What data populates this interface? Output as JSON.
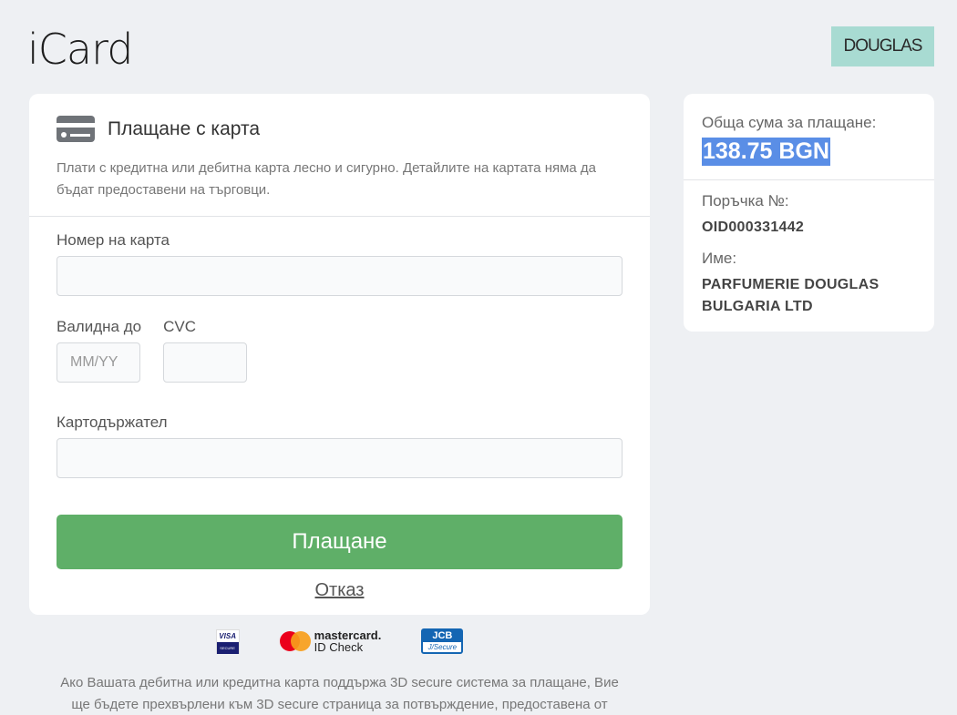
{
  "brand": {
    "name": "iCard"
  },
  "merchant": {
    "logo_text": "DOUGLAS"
  },
  "card_panel": {
    "title": "Плащане с карта",
    "description": "Плати с кредитна или дебитна карта лесно и сигурно. Детайлите на картата няма да бъдат предоставени на търговци.",
    "card_number_label": "Номер на карта",
    "card_number_value": "",
    "expiry_label": "Валидна до",
    "expiry_placeholder": "MM/YY",
    "cvc_label": "CVC",
    "cvc_value": "",
    "holder_label": "Картодържател",
    "holder_value": "",
    "pay_label": "Плащане",
    "cancel_label": "Отказ"
  },
  "summary": {
    "total_label": "Обща сума за плащане:",
    "total_amount": "138.75 BGN",
    "order_label": "Поръчка №:",
    "order_id": "OID000331442",
    "name_label": "Име:",
    "name_value": "PARFUMERIE DOUGLAS BULGARIA LTD"
  },
  "logos": {
    "visa_top": "VISA",
    "visa_bottom": "SECURE",
    "mc_line1": "mastercard.",
    "mc_line2": "ID Check",
    "jcb_top": "JCB",
    "jcb_bottom": "J/Secure"
  },
  "footnote": "Ако Вашата дебитна или кредитна карта поддържа 3D secure система за плащане, Вие ще бъдете прехвърлени към 3D secure страница за потвърждение, предоставена от",
  "colors": {
    "background": "#eef0f3",
    "pay_button": "#5faf68",
    "amount_highlight": "#5a8ee6",
    "merchant_logo_bg": "#a8dbd2"
  }
}
